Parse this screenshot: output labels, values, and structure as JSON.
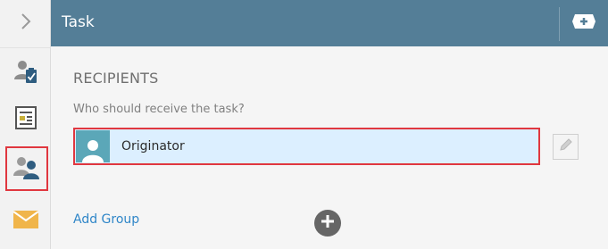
{
  "sidebar": {
    "collapse_icon": "chevron-right-icon",
    "items": [
      {
        "icon": "user-task-icon"
      },
      {
        "icon": "form-icon"
      },
      {
        "icon": "recipients-icon",
        "selected": true
      },
      {
        "icon": "mail-icon"
      }
    ]
  },
  "header": {
    "title": "Task",
    "add_icon": "add-icon"
  },
  "recipients": {
    "section_title": "RECIPIENTS",
    "question": "Who should receive the task?",
    "items": [
      {
        "label": "Originator",
        "icon": "user-avatar-icon"
      }
    ],
    "edit_icon": "pencil-icon",
    "add_group_label": "Add Group",
    "add_icon": "plus-circle-icon"
  },
  "colors": {
    "header_bg": "#547e97",
    "highlight_border": "#e0373f",
    "link": "#2f86c8",
    "row_bg": "#dcefff",
    "avatar_bg": "#5ba7b8",
    "mail_icon": "#f0b54b"
  }
}
